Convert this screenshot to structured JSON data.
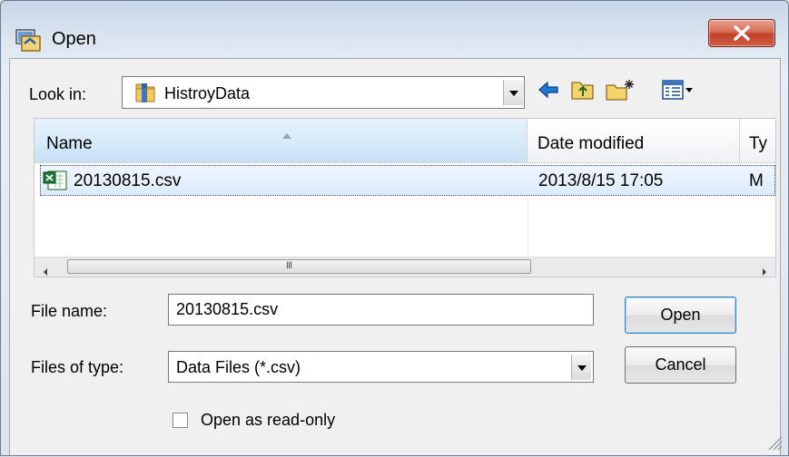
{
  "window": {
    "title": "Open",
    "close_label": "X"
  },
  "look_in": {
    "label": "Look in:",
    "value": "HistroyData"
  },
  "toolbar": {
    "icons": [
      "back-arrow-icon",
      "up-folder-icon",
      "new-folder-icon",
      "view-menu-icon"
    ]
  },
  "file_list": {
    "columns": [
      "Name",
      "Date modified",
      "Ty"
    ],
    "rows": [
      {
        "name": "20130815.csv",
        "date_modified": "2013/8/15 17:05",
        "type": "M",
        "selected": true
      }
    ],
    "scroll_grip": "III"
  },
  "form": {
    "file_name_label": "File name:",
    "file_name_value": "20130815.csv",
    "file_type_label": "Files of type:",
    "file_type_value": "Data Files (*.csv)",
    "read_only_label": "Open as read-only",
    "read_only_checked": false
  },
  "buttons": {
    "open": "Open",
    "cancel": "Cancel"
  },
  "colors": {
    "selection": "#dcebfc",
    "close_button": "#c7432c",
    "default_button_border": "#3c7fb1"
  }
}
